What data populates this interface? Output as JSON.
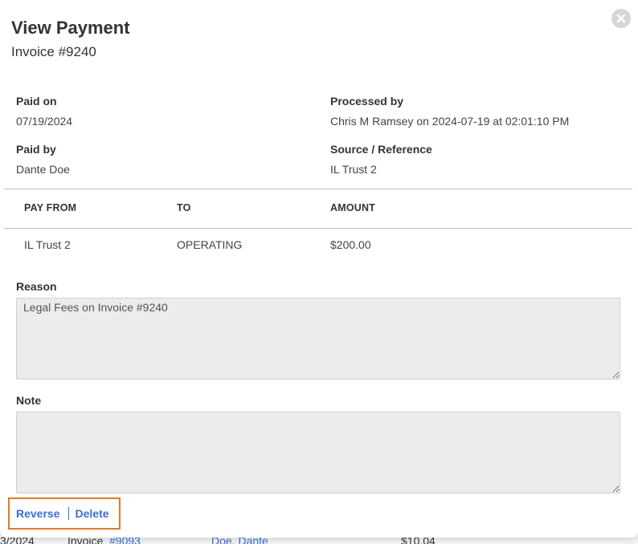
{
  "modal": {
    "title": "View Payment",
    "subtitle": "Invoice #9240"
  },
  "details": {
    "paid_on_label": "Paid on",
    "paid_on_value": "07/19/2024",
    "processed_by_label": "Processed by",
    "processed_by_value": "Chris M Ramsey on 2024-07-19 at 02:01:10 PM",
    "paid_by_label": "Paid by",
    "paid_by_value": "Dante Doe",
    "source_label": "Source / Reference",
    "source_value": "IL Trust 2"
  },
  "table": {
    "headers": [
      "PAY FROM",
      "TO",
      "AMOUNT"
    ],
    "rows": [
      [
        "IL Trust 2",
        "OPERATING",
        "$200.00"
      ]
    ]
  },
  "reason": {
    "label": "Reason",
    "value": "Legal Fees on Invoice #9240"
  },
  "note": {
    "label": "Note",
    "value": ""
  },
  "actions": {
    "reverse_label": "Reverse",
    "delete_label": "Delete"
  },
  "background_row": {
    "date": "3/2024",
    "invoice_prefix": "Invoice ",
    "invoice_link": "#9093",
    "client": "Doe, Dante",
    "amount": "$10.04"
  },
  "colors": {
    "link": "#3b6fd4",
    "highlight": "#e07a2b"
  }
}
